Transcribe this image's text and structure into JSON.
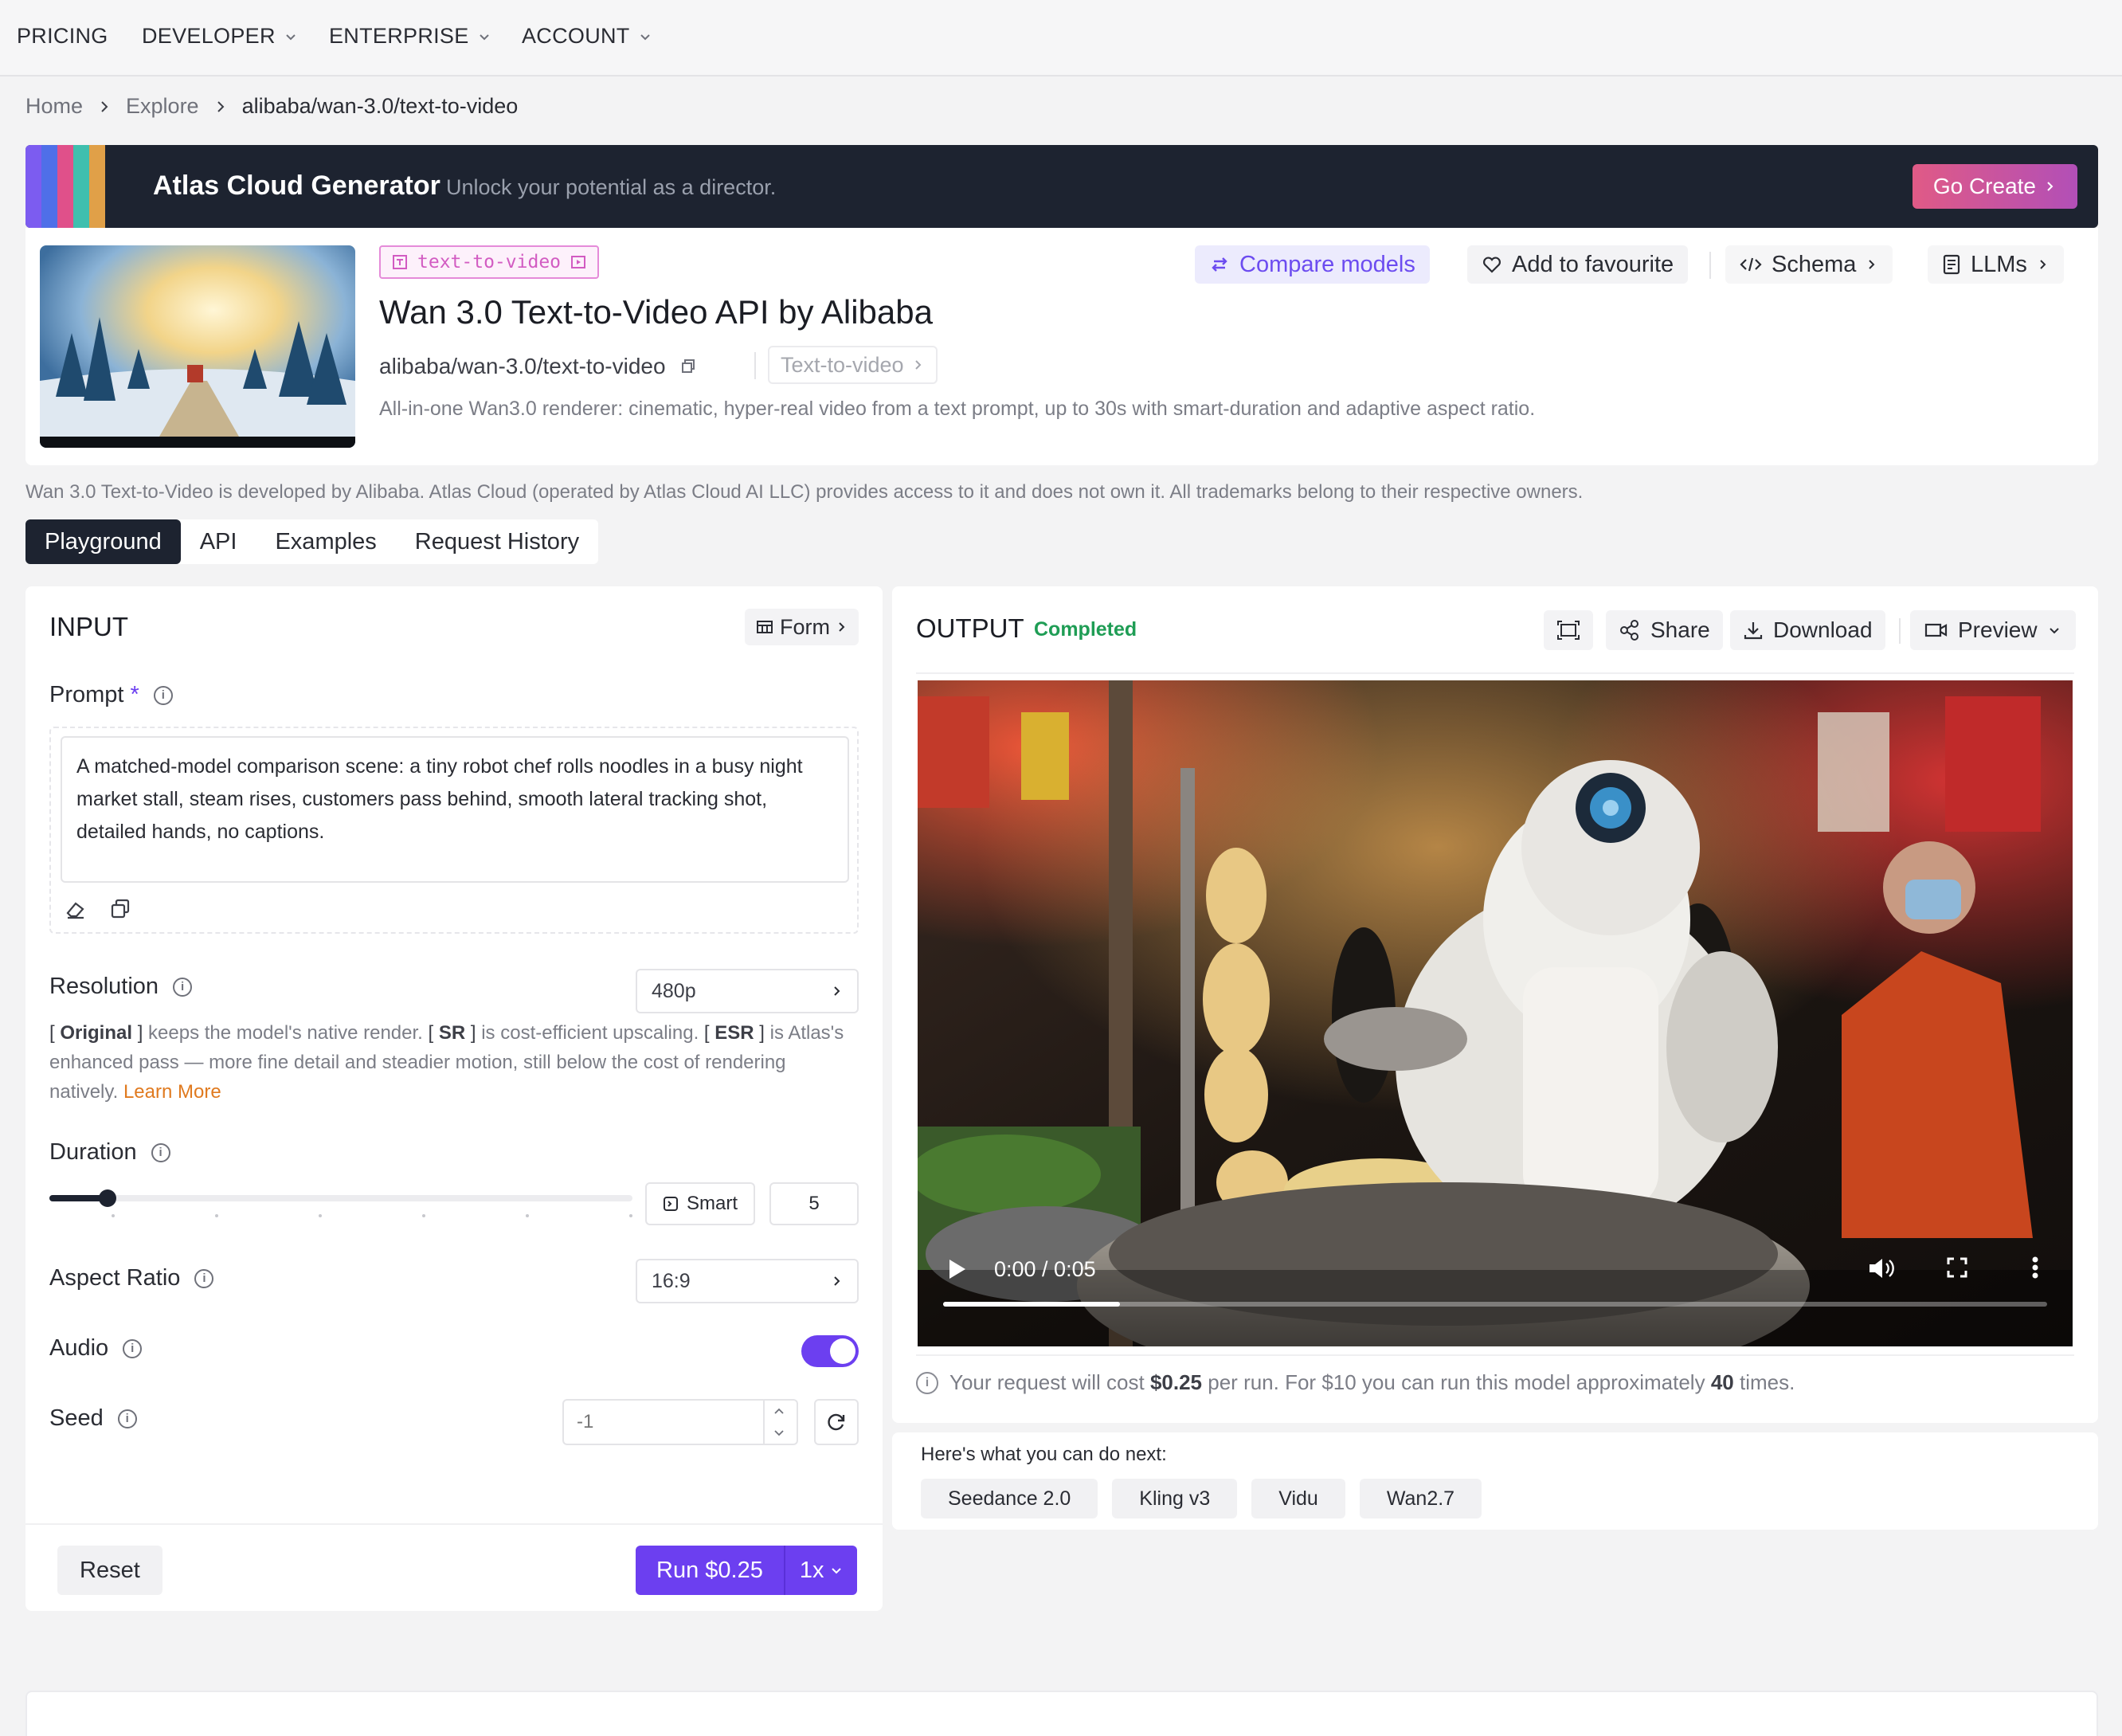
{
  "nav": {
    "items": [
      {
        "label": "PRICING",
        "dropdown": false
      },
      {
        "label": "DEVELOPER",
        "dropdown": true
      },
      {
        "label": "ENTERPRISE",
        "dropdown": true
      },
      {
        "label": "ACCOUNT",
        "dropdown": true
      }
    ]
  },
  "breadcrumb": {
    "home": "Home",
    "explore": "Explore",
    "current": "alibaba/wan-3.0/text-to-video"
  },
  "banner": {
    "title": "Atlas Cloud Generator",
    "subtitle": "Unlock your potential as a director.",
    "cta": "Go Create",
    "stripe_colors": [
      "#7c5cf0",
      "#4f6fe8",
      "#e0508a",
      "#3fbfae",
      "#e0a048"
    ]
  },
  "model": {
    "tag": "text-to-video",
    "title": "Wan 3.0 Text-to-Video API by Alibaba",
    "path": "alibaba/wan-3.0/text-to-video",
    "category": "Text-to-video",
    "description": "All-in-one Wan3.0 renderer: cinematic, hyper-real video from a text prompt, up to 30s with smart-duration and adaptive aspect ratio.",
    "actions": {
      "compare": "Compare models",
      "favourite": "Add to favourite",
      "schema": "Schema",
      "llms": "LLMs"
    }
  },
  "disclaimer": "Wan 3.0 Text-to-Video is developed by Alibaba. Atlas Cloud (operated by Atlas Cloud AI LLC) provides access to it and does not own it. All trademarks belong to their respective owners.",
  "tabs": [
    {
      "label": "Playground",
      "active": true
    },
    {
      "label": "API",
      "active": false
    },
    {
      "label": "Examples",
      "active": false
    },
    {
      "label": "Request History",
      "active": false
    }
  ],
  "input": {
    "title": "INPUT",
    "form_button": "Form",
    "prompt": {
      "label": "Prompt",
      "required_mark": "*",
      "value": "A matched-model comparison scene: a tiny robot chef rolls noodles in a busy night market stall, steam rises, customers pass behind, smooth lateral tracking shot, detailed hands, no captions."
    },
    "resolution": {
      "label": "Resolution",
      "value": "480p",
      "help": {
        "original_tag": "Original",
        "original_text": "keeps the model's native render.",
        "sr_tag": "SR",
        "sr_text": "is cost-efficient upscaling.",
        "esr_tag": "ESR",
        "esr_text": "is Atlas's enhanced pass — more fine detail and steadier motion, still below the cost of rendering natively.",
        "learn_more": "Learn More"
      }
    },
    "duration": {
      "label": "Duration",
      "smart_label": "Smart",
      "value": "5",
      "slider_fraction": 0.1
    },
    "aspect_ratio": {
      "label": "Aspect Ratio",
      "value": "16:9"
    },
    "audio": {
      "label": "Audio",
      "enabled": true
    },
    "seed": {
      "label": "Seed",
      "placeholder": "-1"
    },
    "reset": "Reset",
    "run_label": "Run $0.25",
    "run_multiplier": "1x"
  },
  "output": {
    "title": "OUTPUT",
    "status": "Completed",
    "share": "Share",
    "download": "Download",
    "preview": "Preview",
    "video_time": "0:00 / 0:05",
    "video_progress_fraction": 0.16,
    "cost": {
      "pre": "Your request will cost",
      "price": "$0.25",
      "mid": "per run. For $10 you can run this model approximately",
      "times": "40",
      "post": "times."
    }
  },
  "next": {
    "title": "Here's what you can do next:",
    "chips": [
      "Seedance 2.0",
      "Kling v3",
      "Vidu",
      "Wan2.7"
    ]
  },
  "colors": {
    "accent": "#6c3ff0",
    "status_green": "#1f9d55",
    "learn_more": "#e07a1f",
    "banner_bg": "#1d2330"
  }
}
